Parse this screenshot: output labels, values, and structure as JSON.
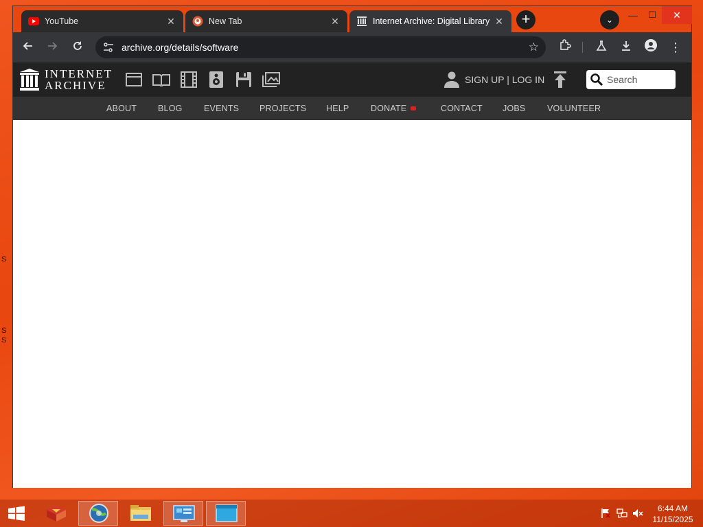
{
  "desktop": {
    "edge_letters": [
      "S",
      "S",
      "S"
    ]
  },
  "browser": {
    "tabs": [
      {
        "title": "YouTube",
        "icon": "youtube-icon"
      },
      {
        "title": "New Tab",
        "icon": "duckduckgo-icon"
      },
      {
        "title": "Internet Archive: Digital Library",
        "icon": "archive-icon",
        "active": true
      }
    ],
    "new_tab_label": "+",
    "url": "archive.org/details/software"
  },
  "archive": {
    "logo_line1": "INTERNET",
    "logo_line2": "ARCHIVE",
    "media_icons": [
      "web-icon",
      "texts-icon",
      "video-icon",
      "audio-icon",
      "software-icon",
      "images-icon"
    ],
    "signup_label": "SIGN UP | LOG IN",
    "search_placeholder": "Search",
    "nav": [
      "ABOUT",
      "BLOG",
      "EVENTS",
      "PROJECTS",
      "HELP",
      "DONATE",
      "CONTACT",
      "JOBS",
      "VOLUNTEER"
    ]
  },
  "taskbar": {
    "time": "6:44 AM",
    "date": "11/15/2025"
  },
  "colors": {
    "desktop": "#e8470f",
    "ia_header": "#222222",
    "ia_nav": "#333333",
    "donate_dot": "#e02020"
  }
}
